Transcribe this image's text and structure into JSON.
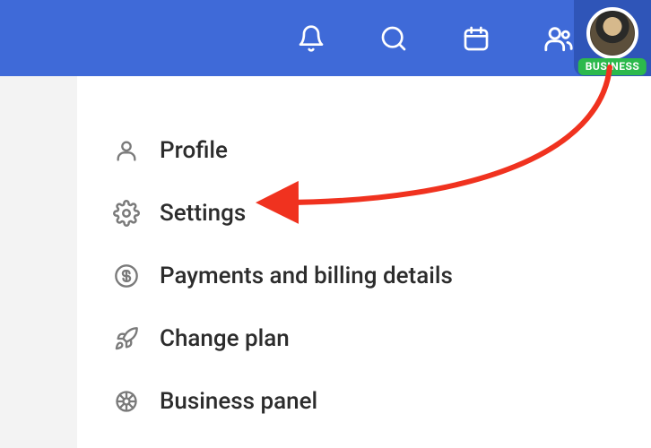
{
  "header": {
    "icons": [
      "bell-icon",
      "search-icon",
      "calendar-icon",
      "people-icon"
    ]
  },
  "avatar": {
    "badge_label": "BUSINESS"
  },
  "menu": {
    "items": [
      {
        "icon": "user-icon",
        "label": "Profile"
      },
      {
        "icon": "gear-icon",
        "label": "Settings"
      },
      {
        "icon": "dollar-icon",
        "label": "Payments and billing details"
      },
      {
        "icon": "rocket-icon",
        "label": "Change plan"
      },
      {
        "icon": "wheel-icon",
        "label": "Business panel"
      }
    ]
  },
  "annotation": {
    "type": "arrow",
    "color": "#f0321f",
    "target": "settings"
  }
}
